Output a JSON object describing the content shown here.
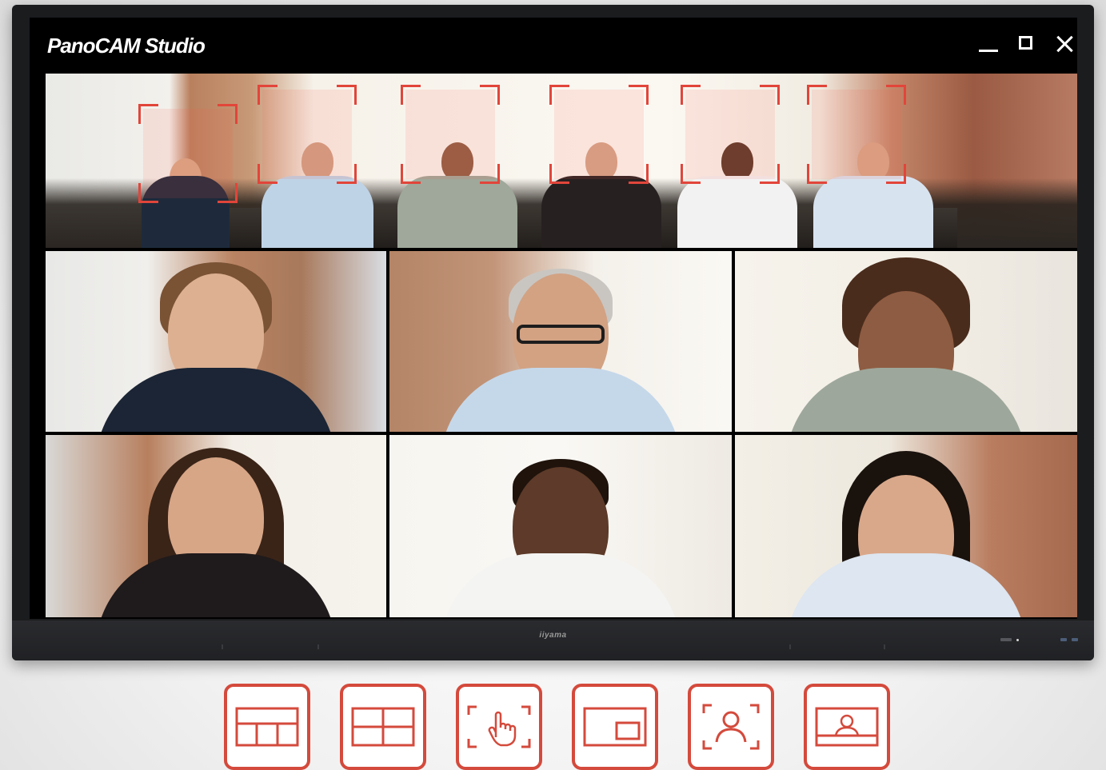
{
  "app": {
    "title": "PanoCAM Studio",
    "brand": "iiyama"
  },
  "window_controls": [
    "minimize",
    "maximize",
    "close"
  ],
  "panorama": {
    "face_boxes_count": 6
  },
  "participants": [
    {
      "id": "woman-ponytail"
    },
    {
      "id": "man-glasses"
    },
    {
      "id": "woman-curly"
    },
    {
      "id": "woman-long-hair"
    },
    {
      "id": "man-smiling"
    },
    {
      "id": "woman-bob"
    }
  ],
  "modes": [
    {
      "icon": "split-layout-icon"
    },
    {
      "icon": "grid-layout-icon"
    },
    {
      "icon": "manual-select-icon"
    },
    {
      "icon": "picture-in-picture-icon"
    },
    {
      "icon": "speaker-tracking-icon"
    },
    {
      "icon": "presenter-view-icon"
    }
  ],
  "colors": {
    "accent": "#e2453a",
    "mode_border": "#d44a3c",
    "titlebar": "#000000",
    "bezel": "#1b1c1e"
  }
}
